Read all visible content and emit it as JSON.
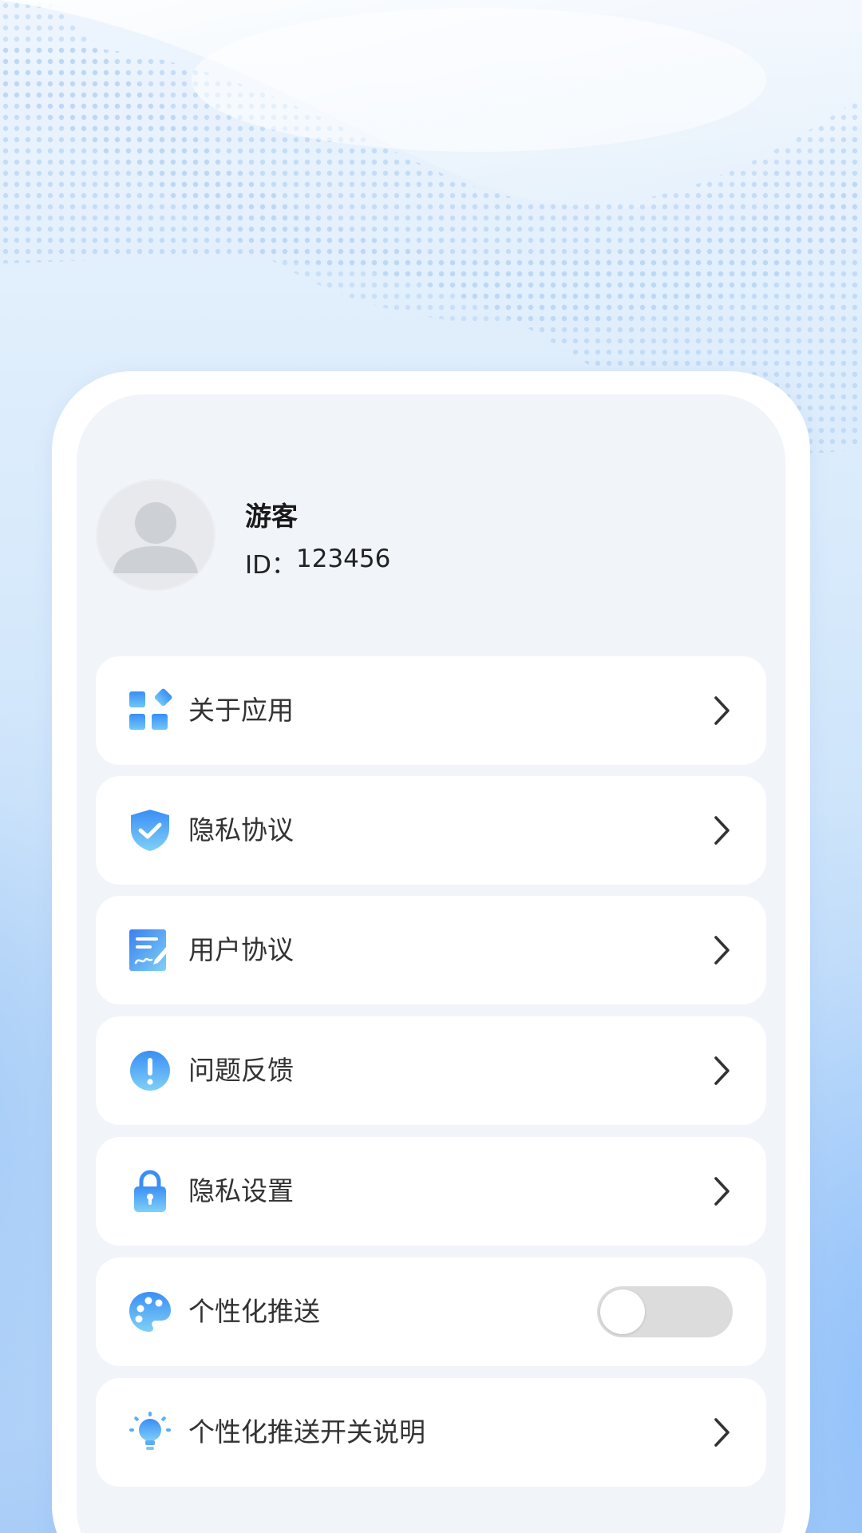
{
  "profile": {
    "name": "游客",
    "id_label": "ID：",
    "id_value": "123456"
  },
  "menu": {
    "items": [
      {
        "label": "关于应用",
        "icon": "apps-icon",
        "action": "chevron"
      },
      {
        "label": "隐私协议",
        "icon": "shield-check-icon",
        "action": "chevron"
      },
      {
        "label": "用户协议",
        "icon": "document-sign-icon",
        "action": "chevron"
      },
      {
        "label": "问题反馈",
        "icon": "alert-circle-icon",
        "action": "chevron"
      },
      {
        "label": "隐私设置",
        "icon": "lock-icon",
        "action": "chevron"
      },
      {
        "label": "个性化推送",
        "icon": "palette-icon",
        "action": "toggle",
        "toggle_on": false
      },
      {
        "label": "个性化推送开关说明",
        "icon": "lightbulb-icon",
        "action": "chevron"
      }
    ]
  },
  "colors": {
    "icon_gradient_start": "#3a8ef5",
    "icon_gradient_end": "#7fd0f7",
    "toggle_off": "#dcdcdc"
  }
}
